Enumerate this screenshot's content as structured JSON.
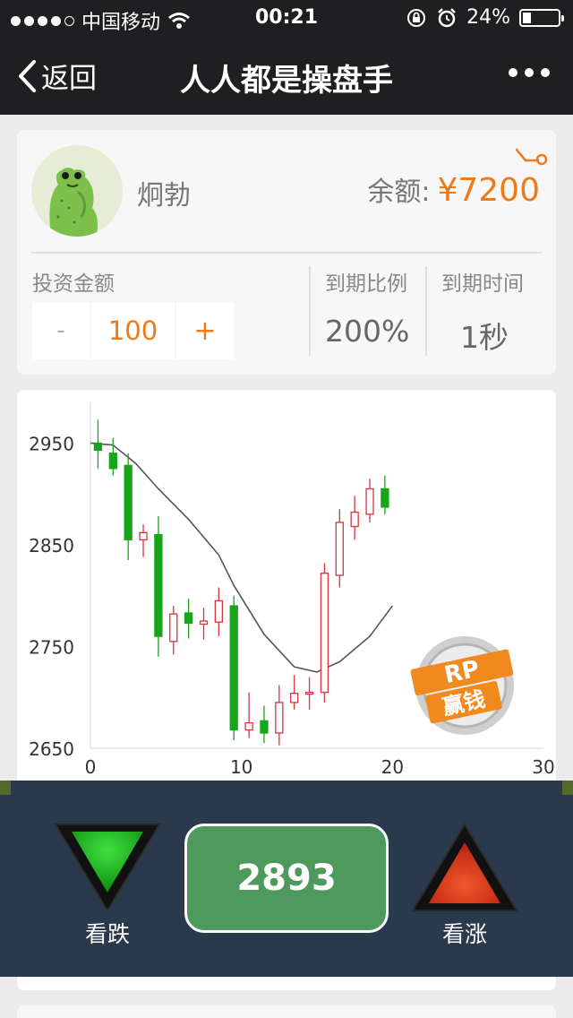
{
  "status_bar": {
    "carrier": "中国移动",
    "time": "00:21",
    "battery": "24%",
    "battery_level": 0.24
  },
  "nav": {
    "back_label": "返回",
    "title": "人人都是操盘手"
  },
  "user": {
    "name": "炯勃",
    "balance_label": "余额:",
    "balance_value": "¥7200"
  },
  "invest": {
    "amount_label": "投资金额",
    "minus": "-",
    "value": "100",
    "plus": "+",
    "ratio_label": "到期比例",
    "ratio_value": "200%",
    "time_label": "到期时间",
    "time_value": "1秒"
  },
  "chart_data": {
    "type": "candlestick",
    "title": "",
    "xlabel": "",
    "ylabel": "",
    "xlim": [
      0,
      30
    ],
    "ylim": [
      2650,
      2990
    ],
    "x_ticks": [
      0,
      10,
      20,
      30
    ],
    "y_ticks": [
      2650,
      2750,
      2850,
      2950
    ],
    "grid": false,
    "candles": [
      {
        "x": 0.5,
        "open": 2950,
        "close": 2943,
        "high": 2973,
        "low": 2925
      },
      {
        "x": 1.5,
        "open": 2940,
        "close": 2925,
        "high": 2955,
        "low": 2918
      },
      {
        "x": 2.5,
        "open": 2928,
        "close": 2855,
        "high": 2940,
        "low": 2835
      },
      {
        "x": 3.5,
        "open": 2855,
        "close": 2862,
        "high": 2870,
        "low": 2838
      },
      {
        "x": 4.5,
        "open": 2860,
        "close": 2760,
        "high": 2878,
        "low": 2740
      },
      {
        "x": 5.5,
        "open": 2755,
        "close": 2782,
        "high": 2790,
        "low": 2742
      },
      {
        "x": 6.5,
        "open": 2783,
        "close": 2773,
        "high": 2797,
        "low": 2758
      },
      {
        "x": 7.5,
        "open": 2772,
        "close": 2775,
        "high": 2788,
        "low": 2757
      },
      {
        "x": 8.5,
        "open": 2774,
        "close": 2795,
        "high": 2808,
        "low": 2760
      },
      {
        "x": 9.5,
        "open": 2790,
        "close": 2668,
        "high": 2800,
        "low": 2658
      },
      {
        "x": 10.5,
        "open": 2668,
        "close": 2675,
        "high": 2705,
        "low": 2660
      },
      {
        "x": 11.5,
        "open": 2677,
        "close": 2665,
        "high": 2692,
        "low": 2655
      },
      {
        "x": 12.5,
        "open": 2665,
        "close": 2695,
        "high": 2712,
        "low": 2653
      },
      {
        "x": 13.5,
        "open": 2695,
        "close": 2704,
        "high": 2722,
        "low": 2688
      },
      {
        "x": 14.5,
        "open": 2705,
        "close": 2705,
        "high": 2720,
        "low": 2688
      },
      {
        "x": 15.5,
        "open": 2705,
        "close": 2822,
        "high": 2832,
        "low": 2695
      },
      {
        "x": 16.5,
        "open": 2820,
        "close": 2872,
        "high": 2885,
        "low": 2808
      },
      {
        "x": 17.5,
        "open": 2868,
        "close": 2882,
        "high": 2898,
        "low": 2855
      },
      {
        "x": 18.5,
        "open": 2880,
        "close": 2905,
        "high": 2915,
        "low": 2872
      },
      {
        "x": 19.5,
        "open": 2905,
        "close": 2887,
        "high": 2918,
        "low": 2880
      }
    ],
    "moving_average": [
      {
        "x": 0,
        "y": 2950
      },
      {
        "x": 1.5,
        "y": 2948
      },
      {
        "x": 3,
        "y": 2930
      },
      {
        "x": 4.5,
        "y": 2905
      },
      {
        "x": 6.5,
        "y": 2875
      },
      {
        "x": 8.5,
        "y": 2840
      },
      {
        "x": 9.5,
        "y": 2810
      },
      {
        "x": 11.5,
        "y": 2762
      },
      {
        "x": 13.5,
        "y": 2730
      },
      {
        "x": 15,
        "y": 2725
      },
      {
        "x": 16.5,
        "y": 2735
      },
      {
        "x": 18.5,
        "y": 2760
      },
      {
        "x": 20,
        "y": 2790
      }
    ],
    "colors": {
      "up": "#d9343f",
      "down": "#17a51a",
      "ma": "#555555"
    }
  },
  "badge": {
    "line1": "RP",
    "line2": "赢钱"
  },
  "trade": {
    "down_label": "看跌",
    "price": "2893",
    "up_label": "看涨"
  }
}
